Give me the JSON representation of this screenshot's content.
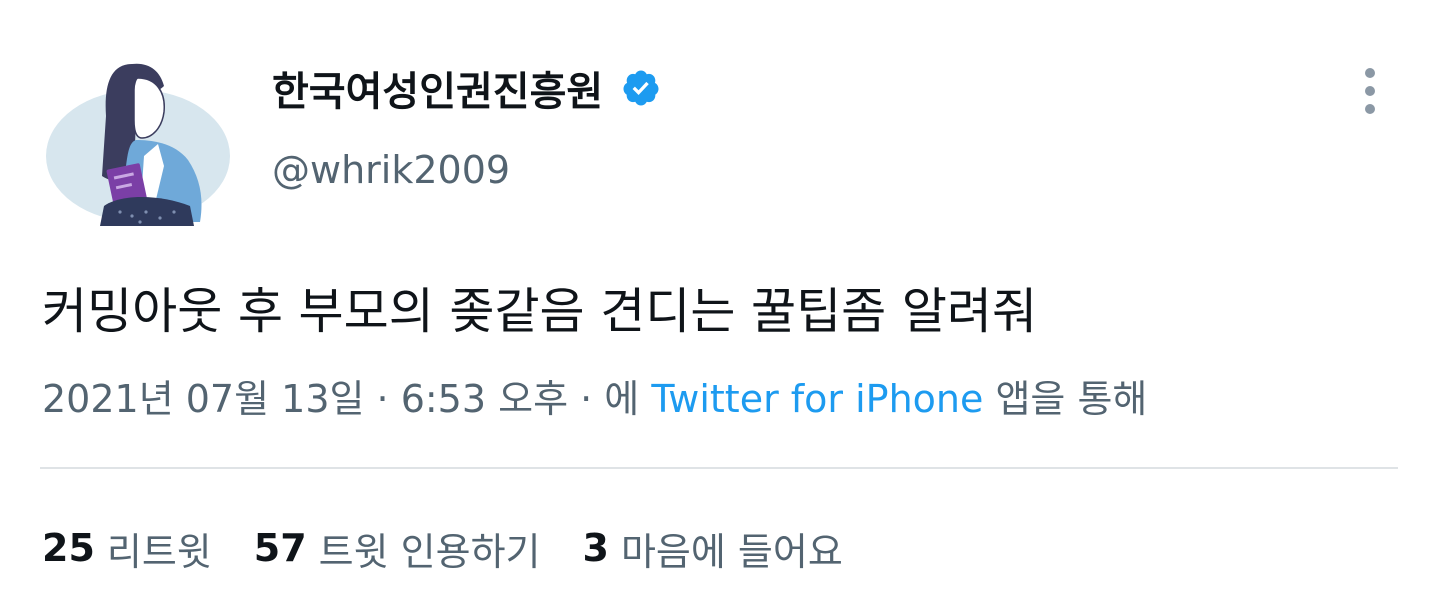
{
  "author": {
    "display_name": "한국여성인권진흥원",
    "handle": "@whrik2009",
    "verified_icon": "verified-badge-icon",
    "verified_color": "#1d9bf0"
  },
  "tweet": {
    "text": "커밍아웃 후 부모의 좆같음 견디는 꿀팁좀 알려줘"
  },
  "meta": {
    "date": "2021년 07월 13일",
    "separator1": " · ",
    "time": "6:53 오후",
    "separator2": " · ",
    "via_prefix": "에 ",
    "source": "Twitter for iPhone",
    "via_suffix": " 앱을 통해"
  },
  "stats": {
    "retweets": {
      "count": "25",
      "label": "리트윗"
    },
    "quotes": {
      "count": "57",
      "label": "트윗 인용하기"
    },
    "likes": {
      "count": "3",
      "label": "마음에 들어요"
    }
  },
  "icons": {
    "more": "more-vertical-icon"
  },
  "colors": {
    "link": "#1d9bf0",
    "secondary_text": "#536471",
    "primary_text": "#0f1419"
  }
}
